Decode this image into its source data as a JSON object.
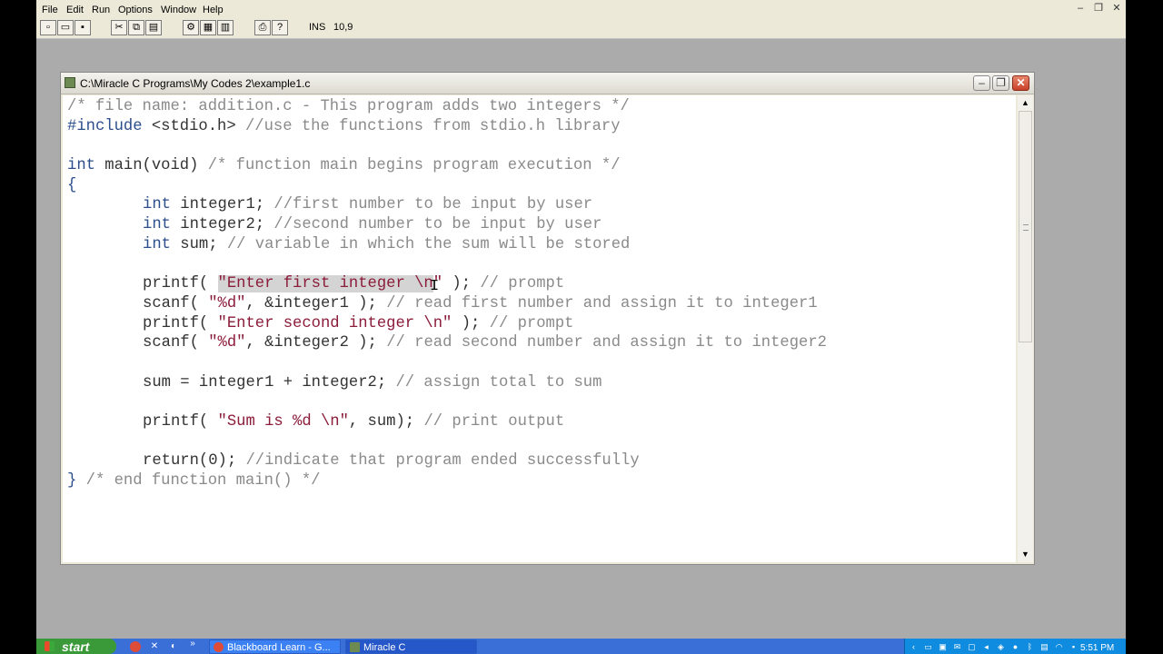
{
  "menu": [
    "File",
    "Edit",
    "Run",
    "Options",
    "Window",
    "Help"
  ],
  "toolbar": {
    "mode": "INS",
    "position": "10,9",
    "buttons": [
      "new-file-icon",
      "open-folder-icon",
      "save-icon",
      "cut-icon",
      "copy-icon",
      "paste-icon",
      "compile-icon",
      "build-icon",
      "run-icon",
      "print-icon",
      "help-icon"
    ]
  },
  "window": {
    "title": "C:\\Miracle C Programs\\My Codes 2\\example1.c",
    "buttons": {
      "minimize": "–",
      "restore": "❐",
      "close": "✕"
    }
  },
  "code": {
    "l1": "/* file name: addition.c - This program adds two integers */",
    "l2a": "#include",
    "l2b": " <stdio.h> ",
    "l2c": "//use the functions from stdio.h library",
    "l4a": "int",
    "l4b": " main(void) ",
    "l4c": "/* function main begins program execution */",
    "l5": "{",
    "l6a": "int",
    "l6b": " integer1; ",
    "l6c": "//first number to be input by user",
    "l7a": "int",
    "l7b": " integer2; ",
    "l7c": "//second number to be input by user",
    "l8a": "int",
    "l8b": " sum; ",
    "l8c": "// variable in which the sum will be stored",
    "l10a": "printf( ",
    "l10b": "\"Enter first integer \\n",
    "l10c": "\"",
    "l10d": " ); ",
    "l10e": "// prompt",
    "l11a": "scanf( ",
    "l11b": "\"%d\"",
    "l11c": ", &integer1 ); ",
    "l11d": "// read first number and assign it to integer1",
    "l12a": "printf( ",
    "l12b": "\"Enter second integer \\n\"",
    "l12c": " ); ",
    "l12d": "// prompt",
    "l13a": "scanf( ",
    "l13b": "\"%d\"",
    "l13c": ", &integer2 ); ",
    "l13d": "// read second number and assign it to integer2",
    "l15a": "sum = integer1 + integer2; ",
    "l15b": "// assign total to sum",
    "l17a": "printf( ",
    "l17b": "\"Sum is %d \\n\"",
    "l17c": ", sum); ",
    "l17d": "// print output",
    "l19a": "return",
    "l19b": "(0); ",
    "l19c": "//indicate that program ended successfully",
    "l20a": "} ",
    "l20b": "/* end function main() */"
  },
  "taskbar": {
    "start": "start",
    "more": "»",
    "tasks": [
      {
        "label": "Blackboard Learn - G...",
        "icon": "chrome-icon"
      },
      {
        "label": "Miracle C",
        "icon": "miracle-c-icon"
      }
    ],
    "clock": "5:51 PM"
  }
}
